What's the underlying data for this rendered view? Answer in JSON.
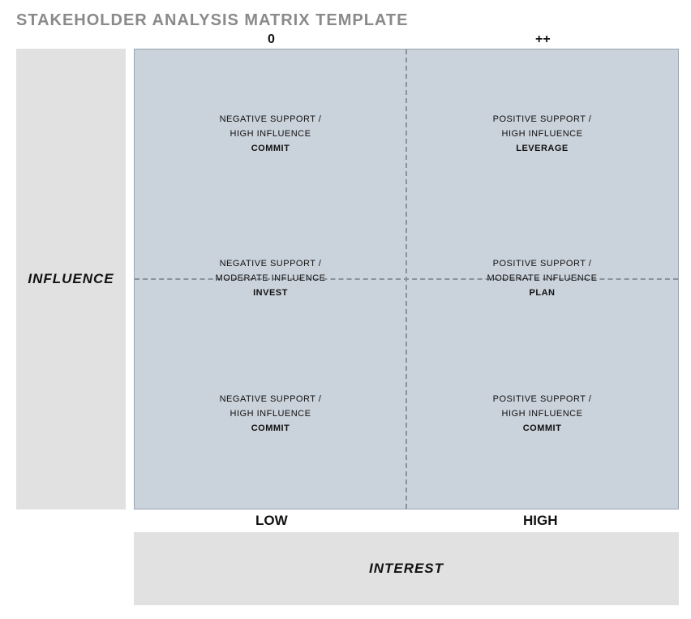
{
  "title": "STAKEHOLDER ANALYSIS MATRIX TEMPLATE",
  "axes": {
    "y_label": "INFLUENCE",
    "x_label": "INTEREST",
    "top_scale": {
      "left": "0",
      "right": "++"
    },
    "bottom_scale": {
      "left": "LOW",
      "right": "HIGH"
    }
  },
  "cells": {
    "top_left": {
      "line1": "NEGATIVE SUPPORT /",
      "line2": "HIGH INFLUENCE",
      "action": "COMMIT"
    },
    "top_right": {
      "line1": "POSITIVE SUPPORT /",
      "line2": "HIGH INFLUENCE",
      "action": "LEVERAGE"
    },
    "mid_left": {
      "line1": "NEGATIVE SUPPORT /",
      "line2": "MODERATE INFLUENCE",
      "action": "INVEST"
    },
    "mid_right": {
      "line1": "POSITIVE SUPPORT /",
      "line2": "MODERATE INFLUENCE",
      "action": "PLAN"
    },
    "bottom_left": {
      "line1": "NEGATIVE SUPPORT /",
      "line2": "HIGH INFLUENCE",
      "action": "COMMIT"
    },
    "bottom_right": {
      "line1": "POSITIVE SUPPORT /",
      "line2": "HIGH INFLUENCE",
      "action": "COMMIT"
    }
  }
}
